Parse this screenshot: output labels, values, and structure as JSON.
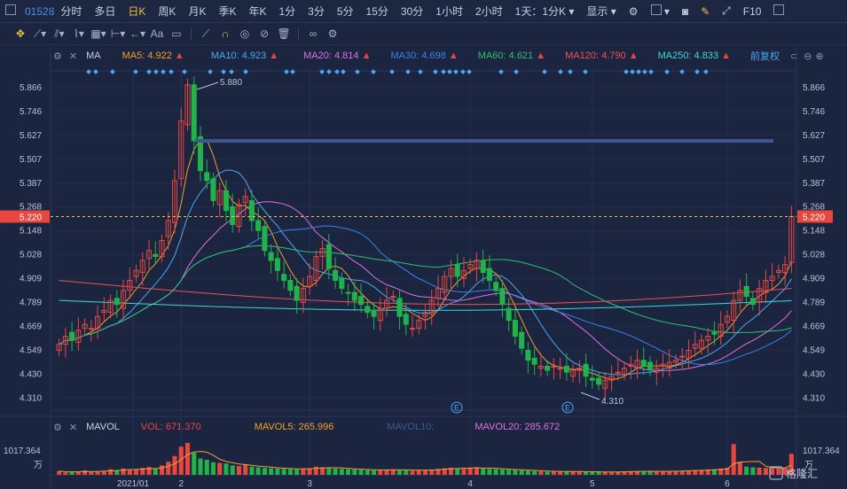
{
  "stock_code": "01528",
  "top_tabs": [
    "分时",
    "多日",
    "日K",
    "周K",
    "月K",
    "季K",
    "年K",
    "1分",
    "3分",
    "5分",
    "15分",
    "30分",
    "1小时",
    "2小时"
  ],
  "active_tab": "日K",
  "period_select": "1天：1分K",
  "display_label": "显示",
  "f10_label": "F10",
  "toolbar": {
    "text_tool": "Aa"
  },
  "ma_bar": {
    "title": "MA",
    "ma5": "MA5: 4.922",
    "ma10": "MA10: 4.923",
    "ma20": "MA20: 4.814",
    "ma30": "MA30: 4.698",
    "ma60": "MA60: 4.621",
    "ma120": "MA120: 4.790",
    "ma250": "MA250: 4.833",
    "adjust": "前复权"
  },
  "vol_bar": {
    "title": "MAVOL",
    "vol": "VOL: 671.370",
    "mavol5": "MAVOL5: 265.996",
    "mavol10": "MAVOL10:",
    "mavol20": "MAVOL20: 285.672"
  },
  "price_ticks": [
    "5.866",
    "5.746",
    "5.627",
    "5.507",
    "5.387",
    "5.268",
    "5.148",
    "5.028",
    "4.909",
    "4.789",
    "4.669",
    "4.549",
    "4.430",
    "4.310"
  ],
  "current_price": "5.220",
  "high_label": "5.880",
  "low_label": "4.310",
  "event_marker": "E",
  "vol_axis": {
    "value": "1017.364",
    "unit": "万"
  },
  "date_labels": [
    "2021/01",
    "2",
    "3",
    "4",
    "5",
    "6"
  ],
  "logo_text": "格隆汇",
  "colors": {
    "up": "#e8473f",
    "down": "#21b34a",
    "ma5": "#f0a030",
    "ma10": "#4aa8f0",
    "ma20": "#e070e0",
    "ma30": "#3b83f0",
    "ma60": "#30c070",
    "ma120": "#f05050",
    "ma250": "#40d8d8",
    "accent": "#f0c040"
  },
  "chart_data": {
    "type": "candlestick",
    "x": [
      "2021-01-04",
      "2021-01-05",
      "2021-01-06",
      "2021-01-07",
      "2021-01-08",
      "2021-01-11",
      "2021-01-12",
      "2021-01-13",
      "2021-01-14",
      "2021-01-15",
      "2021-01-18",
      "2021-01-19",
      "2021-01-20",
      "2021-01-21",
      "2021-01-22",
      "2021-01-25",
      "2021-01-26",
      "2021-01-27",
      "2021-01-28",
      "2021-01-29",
      "2021-02-01",
      "2021-02-02",
      "2021-02-03",
      "2021-02-04",
      "2021-02-05",
      "2021-02-08",
      "2021-02-09",
      "2021-02-10",
      "2021-02-11",
      "2021-02-12",
      "2021-02-15",
      "2021-02-16",
      "2021-02-17",
      "2021-02-18",
      "2021-02-19",
      "2021-02-22",
      "2021-02-23",
      "2021-02-24",
      "2021-02-25",
      "2021-02-26",
      "2021-03-01",
      "2021-03-02",
      "2021-03-03",
      "2021-03-04",
      "2021-03-05",
      "2021-03-08",
      "2021-03-09",
      "2021-03-10",
      "2021-03-11",
      "2021-03-12",
      "2021-03-15",
      "2021-03-16",
      "2021-03-17",
      "2021-03-18",
      "2021-03-19",
      "2021-03-22",
      "2021-03-23",
      "2021-03-24",
      "2021-03-25",
      "2021-03-26",
      "2021-03-29",
      "2021-03-30",
      "2021-03-31",
      "2021-04-01",
      "2021-04-06",
      "2021-04-07",
      "2021-04-08",
      "2021-04-09",
      "2021-04-12",
      "2021-04-13",
      "2021-04-14",
      "2021-04-15",
      "2021-04-16",
      "2021-04-19",
      "2021-04-20",
      "2021-04-21",
      "2021-04-22",
      "2021-04-23",
      "2021-04-26",
      "2021-04-27",
      "2021-04-28",
      "2021-04-29",
      "2021-04-30",
      "2021-05-03",
      "2021-05-04",
      "2021-05-05",
      "2021-05-06",
      "2021-05-07",
      "2021-05-10",
      "2021-05-11",
      "2021-05-12",
      "2021-05-13",
      "2021-05-14",
      "2021-05-17",
      "2021-05-18",
      "2021-05-19",
      "2021-05-20",
      "2021-05-21",
      "2021-05-24",
      "2021-05-25",
      "2021-05-26",
      "2021-05-27",
      "2021-05-28",
      "2021-05-31",
      "2021-06-01",
      "2021-06-02",
      "2021-06-03",
      "2021-06-04",
      "2021-06-07",
      "2021-06-08",
      "2021-06-09",
      "2021-06-10",
      "2021-06-11",
      "2021-06-14",
      "2021-06-15",
      "2021-06-16"
    ],
    "close": [
      4.58,
      4.62,
      4.6,
      4.65,
      4.68,
      4.66,
      4.72,
      4.75,
      4.8,
      4.78,
      4.85,
      4.9,
      4.95,
      5.0,
      5.05,
      5.02,
      5.1,
      5.2,
      5.4,
      5.7,
      5.88,
      5.6,
      5.45,
      5.4,
      5.3,
      5.35,
      5.25,
      5.18,
      5.28,
      5.32,
      5.2,
      5.15,
      5.05,
      5.0,
      4.95,
      4.9,
      4.85,
      4.8,
      4.86,
      4.92,
      5.02,
      5.06,
      4.96,
      4.9,
      4.86,
      4.84,
      4.8,
      4.78,
      4.74,
      4.72,
      4.76,
      4.8,
      4.82,
      4.72,
      4.68,
      4.66,
      4.7,
      4.74,
      4.8,
      4.86,
      4.92,
      4.96,
      4.92,
      4.95,
      4.98,
      5.0,
      4.94,
      4.9,
      4.85,
      4.78,
      4.7,
      4.62,
      4.56,
      4.5,
      4.48,
      4.47,
      4.45,
      4.47,
      4.46,
      4.44,
      4.45,
      4.46,
      4.42,
      4.4,
      4.38,
      4.4,
      4.42,
      4.44,
      4.46,
      4.48,
      4.5,
      4.47,
      4.45,
      4.46,
      4.48,
      4.49,
      4.5,
      4.52,
      4.55,
      4.58,
      4.6,
      4.62,
      4.63,
      4.68,
      4.72,
      4.8,
      4.85,
      4.82,
      4.78,
      4.86,
      4.9,
      4.92,
      4.95,
      4.98,
      5.22
    ],
    "volume": [
      120,
      80,
      90,
      100,
      140,
      95,
      110,
      130,
      180,
      150,
      200,
      170,
      160,
      220,
      250,
      190,
      300,
      420,
      600,
      900,
      1017,
      700,
      520,
      480,
      400,
      380,
      360,
      300,
      280,
      320,
      260,
      240,
      220,
      210,
      200,
      190,
      180,
      170,
      200,
      210,
      260,
      240,
      220,
      200,
      190,
      180,
      170,
      160,
      150,
      140,
      160,
      170,
      175,
      150,
      140,
      130,
      150,
      160,
      170,
      190,
      210,
      230,
      200,
      210,
      230,
      240,
      200,
      190,
      180,
      170,
      160,
      150,
      140,
      130,
      120,
      110,
      100,
      110,
      105,
      100,
      105,
      110,
      95,
      90,
      85,
      90,
      95,
      100,
      110,
      115,
      120,
      110,
      105,
      100,
      115,
      120,
      125,
      130,
      140,
      150,
      160,
      170,
      180,
      200,
      220,
      980,
      420,
      260,
      240,
      230,
      220,
      210,
      200,
      230,
      671.37
    ]
  }
}
